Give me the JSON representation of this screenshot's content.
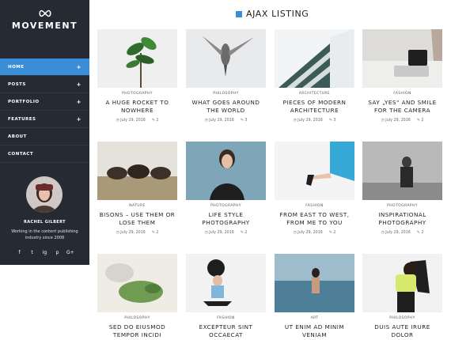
{
  "brand": {
    "name": "MOVEMENT"
  },
  "nav": [
    {
      "label": "HOME",
      "plus": "+",
      "active": true
    },
    {
      "label": "POSTS",
      "plus": "+"
    },
    {
      "label": "PORTFOLIO",
      "plus": "+"
    },
    {
      "label": "FEATURES",
      "plus": "+"
    },
    {
      "label": "ABOUT",
      "plus": ""
    },
    {
      "label": "CONTACT",
      "plus": ""
    }
  ],
  "author": {
    "name": "RACHEL GILBERT",
    "bio": "Working in the content publishing industry since 2008"
  },
  "social": [
    "f",
    "t",
    "ig",
    "p",
    "G+"
  ],
  "heading": "AJAX LISTING",
  "posts": [
    {
      "cat": "PHOTOGRAPHY",
      "title": "A HUGE ROCKET TO NOWHERE",
      "date": "July 29, 2016",
      "comments": "2"
    },
    {
      "cat": "PHILOSOPHY",
      "title": "WHAT GOES AROUND THE WORLD",
      "date": "July 29, 2016",
      "comments": "3"
    },
    {
      "cat": "ARCHITECTURE",
      "title": "PIECES OF MODERN ARCHITECTURE",
      "date": "July 29, 2016",
      "comments": "3"
    },
    {
      "cat": "FASHION",
      "title": "SAY „YES\" AND SMILE FOR THE CAMERA",
      "date": "July 29, 2016",
      "comments": "2"
    },
    {
      "cat": "NATURE",
      "title": "BISONS – USE THEM OR LOSE THEM",
      "date": "July 29, 2016",
      "comments": "2"
    },
    {
      "cat": "PHOTOGRAPHY",
      "title": "LIFE STYLE PHOTOGRAPHY",
      "date": "July 29, 2016",
      "comments": "2"
    },
    {
      "cat": "FASHION",
      "title": "FROM EAST TO WEST, FROM ME TO YOU",
      "date": "July 29, 2016",
      "comments": "2"
    },
    {
      "cat": "PHOTOGRAPHY",
      "title": "INSPIRATIONAL PHOTOGRAPHY",
      "date": "July 29, 2016",
      "comments": "2"
    },
    {
      "cat": "PHILOSOPHY",
      "title": "SED DO EIUSMOD TEMPOR INCIDI",
      "date": "",
      "comments": ""
    },
    {
      "cat": "FASHION",
      "title": "EXCEPTEUR SINT OCCAECAT",
      "date": "",
      "comments": ""
    },
    {
      "cat": "ART",
      "title": "UT ENIM AD MINIM VENIAM",
      "date": "",
      "comments": ""
    },
    {
      "cat": "PHILOSOPHY",
      "title": "DUIS AUTE IRURE DOLOR",
      "date": "",
      "comments": ""
    }
  ]
}
